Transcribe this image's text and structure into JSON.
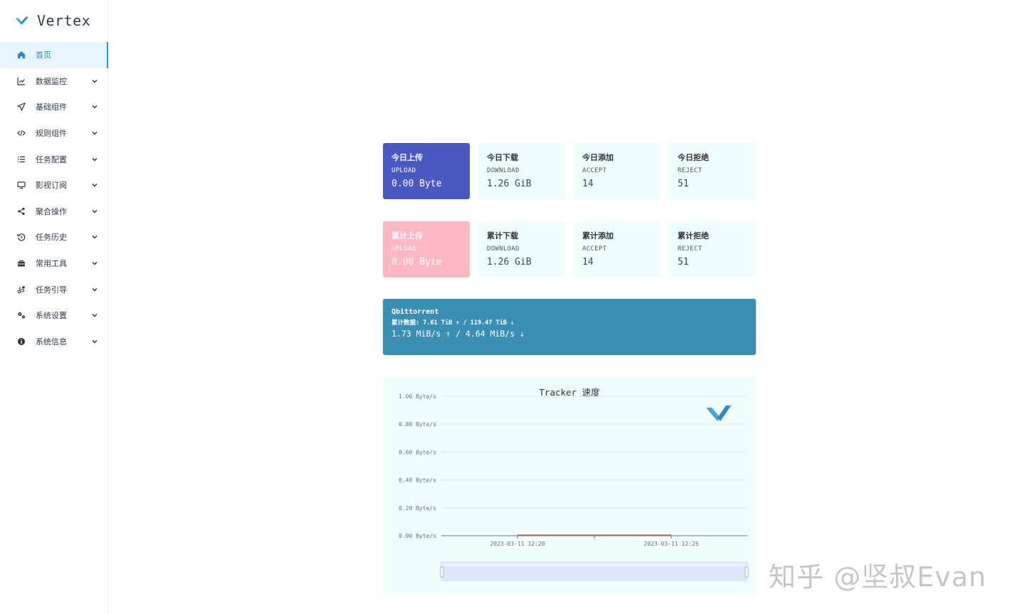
{
  "brand": {
    "name": "Vertex"
  },
  "menu": [
    {
      "label": "首页",
      "icon": "home-icon",
      "active": true,
      "chevron": false
    },
    {
      "label": "数据监控",
      "icon": "line-chart-icon",
      "chevron": true
    },
    {
      "label": "基础组件",
      "icon": "send-icon",
      "chevron": true
    },
    {
      "label": "规则组件",
      "icon": "code-icon",
      "chevron": true
    },
    {
      "label": "任务配置",
      "icon": "list-icon",
      "chevron": true
    },
    {
      "label": "影视订阅",
      "icon": "monitor-icon",
      "chevron": true
    },
    {
      "label": "聚合操作",
      "icon": "share-icon",
      "chevron": true
    },
    {
      "label": "任务历史",
      "icon": "history-icon",
      "chevron": true
    },
    {
      "label": "常用工具",
      "icon": "toolbox-icon",
      "chevron": true
    },
    {
      "label": "任务引导",
      "icon": "route-icon",
      "chevron": true
    },
    {
      "label": "系统设置",
      "icon": "gears-icon",
      "chevron": true
    },
    {
      "label": "系统信息",
      "icon": "info-icon",
      "chevron": true
    }
  ],
  "today": [
    {
      "title": "今日上传",
      "sub": "UPLOAD",
      "value": "0.00 Byte",
      "style": "blue"
    },
    {
      "title": "今日下载",
      "sub": "DOWNLOAD",
      "value": "1.26 GiB",
      "style": "plain"
    },
    {
      "title": "今日添加",
      "sub": "ACCEPT",
      "value": "14",
      "style": "plain"
    },
    {
      "title": "今日拒绝",
      "sub": "REJECT",
      "value": "51",
      "style": "plain"
    }
  ],
  "total": [
    {
      "title": "累计上传",
      "sub": "UPLOAD",
      "value": "0.00 Byte",
      "style": "pink"
    },
    {
      "title": "累计下载",
      "sub": "DOWNLOAD",
      "value": "1.26 GiB",
      "style": "plain"
    },
    {
      "title": "累计添加",
      "sub": "ACCEPT",
      "value": "14",
      "style": "plain"
    },
    {
      "title": "累计拒绝",
      "sub": "REJECT",
      "value": "51",
      "style": "plain"
    }
  ],
  "client": {
    "name": "Qbittorrent",
    "total": "累计数据: 7.61 TiB ↑ / 119.47 TiB ↓",
    "speed": "1.73 MiB/s ↑ / 4.64 MiB/s ↓"
  },
  "chart_data": {
    "type": "line",
    "title": "Tracker 速度",
    "y_ticks": [
      "1.00 Byte/s",
      "0.80 Byte/s",
      "0.60 Byte/s",
      "0.40 Byte/s",
      "0.20 Byte/s",
      "0.00 Byte/s"
    ],
    "x_ticks": [
      "2023-03-11 12:20",
      "2023-03-11 12:25"
    ],
    "ylim": [
      0,
      1
    ],
    "series": [
      {
        "values": [
          0,
          0,
          0,
          0,
          0
        ],
        "color": "#e4603c"
      }
    ],
    "grid": true,
    "has_zoom_slider": true,
    "colors": {
      "grid": "#e1e6ea",
      "axis": "#6e7079",
      "slider": "#dbe6f8"
    }
  },
  "watermark": "知乎 @坚叔Evan"
}
